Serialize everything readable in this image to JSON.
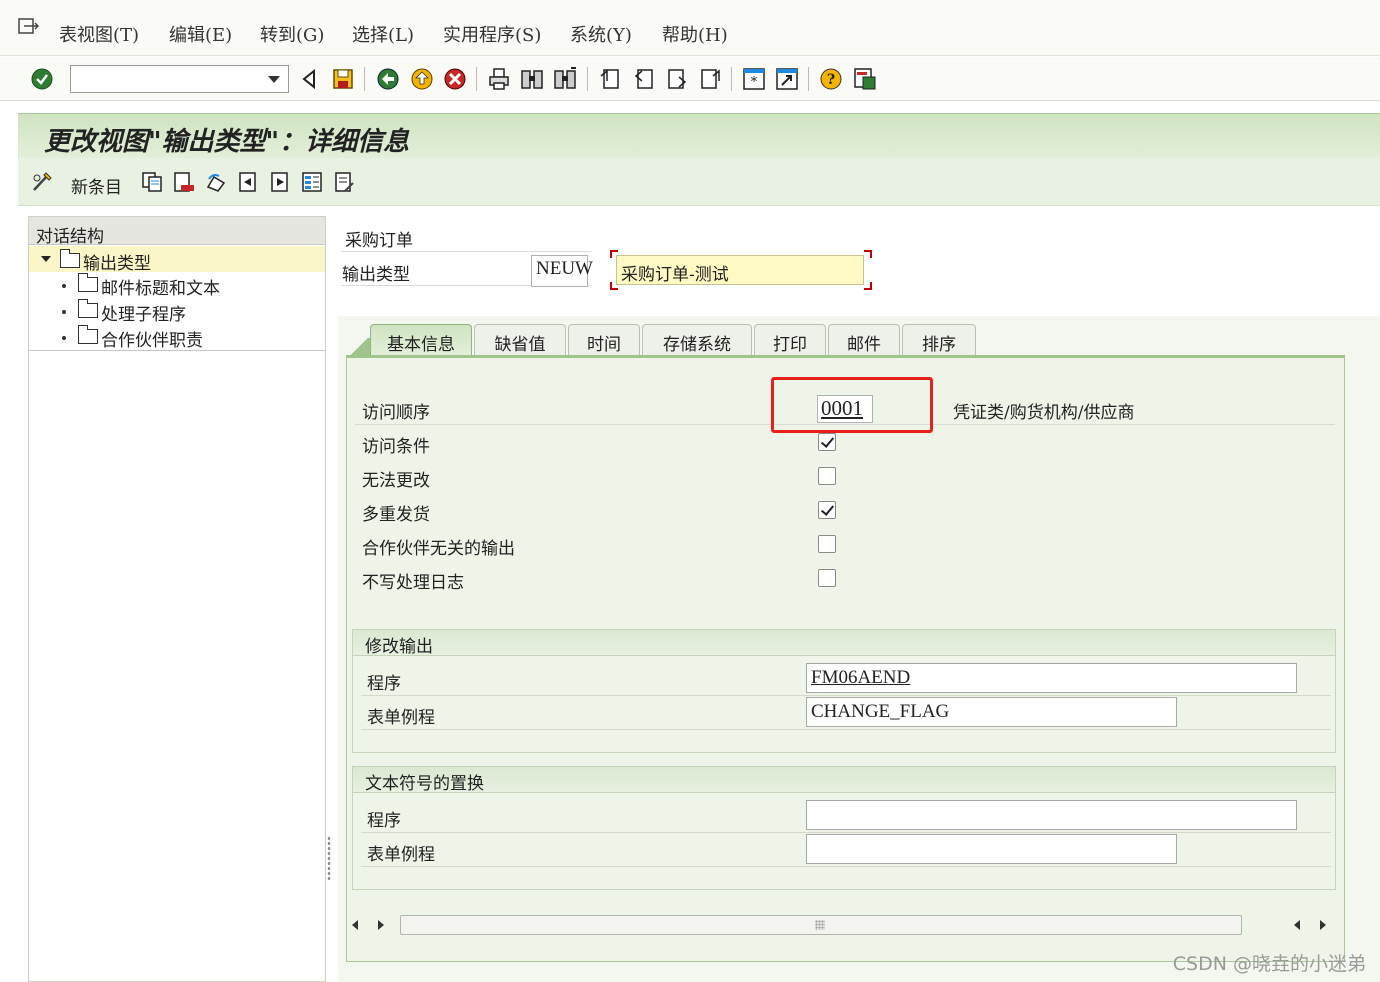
{
  "menu": {
    "items": [
      "表视图(T)",
      "编辑(E)",
      "转到(G)",
      "选择(L)",
      "实用程序(S)",
      "系统(Y)",
      "帮助(H)"
    ]
  },
  "toolbar": {
    "command_field_value": ""
  },
  "page": {
    "title": "更改视图\"输出类型\"：详细信息",
    "new_entry_label": "新条目"
  },
  "nav": {
    "header": "对话结构",
    "root": "输出类型",
    "items": [
      "邮件标题和文本",
      "处理子程序",
      "合作伙伴职责"
    ]
  },
  "header": {
    "app_label": "采购订单",
    "output_type_label": "输出类型",
    "output_type_code": "NEUW",
    "output_type_desc": "采购订单-测试"
  },
  "tabs": [
    "基本信息",
    "缺省值",
    "时间",
    "存储系统",
    "打印",
    "邮件",
    "排序"
  ],
  "basic": {
    "access_seq_label": "访问顺序",
    "access_seq_value": "0001",
    "access_seq_desc": "凭证类/购货机构/供应商",
    "checkboxes": [
      {
        "label": "访问条件",
        "checked": true
      },
      {
        "label": "无法更改",
        "checked": false
      },
      {
        "label": "多重发货",
        "checked": true
      },
      {
        "label": "合作伙伴无关的输出",
        "checked": false
      },
      {
        "label": "不写处理日志",
        "checked": false
      }
    ]
  },
  "change_output": {
    "title": "修改输出",
    "program_label": "程序",
    "program_value": "FM06AEND",
    "form_label": "表单例程",
    "form_value": "CHANGE_FLAG"
  },
  "text_symbols": {
    "title": "文本符号的置换",
    "program_label": "程序",
    "program_value": "",
    "form_label": "表单例程",
    "form_value": ""
  },
  "watermark": "CSDN @晓垚的小迷弟",
  "colors": {
    "title_band": "#cfe3c2",
    "highlight": "#e8201c",
    "desc_field": "#fff9c4"
  }
}
